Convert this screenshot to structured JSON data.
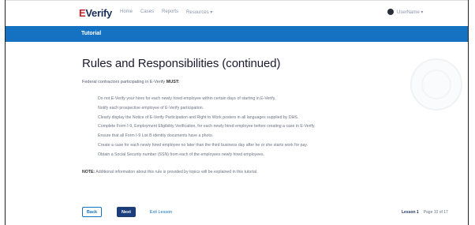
{
  "nav": {
    "logo_e": "E",
    "logo_rest": "Verify",
    "links": [
      "Home",
      "Cases",
      "Reports",
      "Resources ▾"
    ],
    "user_label": "UserName ▾"
  },
  "banner": {
    "label": "Tutorial"
  },
  "main": {
    "title": "Rules and Responsibilities (continued)",
    "intro_prefix": "Federal contractors participating in E-Verify",
    "intro_emph": "MUST:",
    "rules": [
      "Do not E-Verify your hires for each newly hired employee within certain days of starting in E-Verify.",
      "Notify each prospective employee of E-Verify participation.",
      "Clearly display the Notice of E-Verify Participation and Right to Work posters in all languages supplied by DHS.",
      "Complete Form I-9, Employment Eligibility Verification, for each newly hired employee before creating a case in E-Verify.",
      "Ensure that all Form I-9 List B identity documents have a photo.",
      "Create a case for each newly hired employee no later than the third business day after he or she starts work for pay.",
      "Obtain a Social Security number (SSN) from each of the employees newly hired employees."
    ],
    "note_label": "NOTE:",
    "note_text": "Additional information about this rule is provided by topics will be explained in this tutorial."
  },
  "footer": {
    "back_label": "Back",
    "next_label": "Next",
    "exit_label": "Exit Lesson",
    "lesson_label": "Lesson 1",
    "page_label": "Page 10 of 17"
  }
}
